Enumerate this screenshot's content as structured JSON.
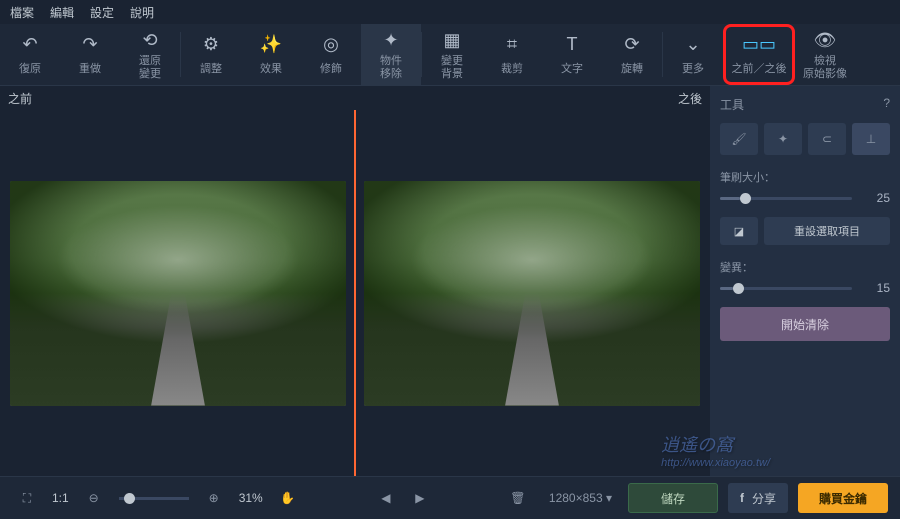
{
  "menu": {
    "file": "檔案",
    "edit": "編輯",
    "settings": "設定",
    "help": "說明"
  },
  "toolbar": {
    "undo": "復原",
    "redo": "重做",
    "revert": "還原\n變更",
    "adjust": "調整",
    "effects": "效果",
    "retouch": "修飾",
    "remove": "物件\n移除",
    "bgchange": "變更\n背景",
    "crop": "裁剪",
    "text": "文字",
    "rotate": "旋轉",
    "more": "更多",
    "beforeafter": "之前／之後",
    "original": "檢視\n原始影像"
  },
  "labels": {
    "before": "之前",
    "after": "之後"
  },
  "panel": {
    "title": "工具",
    "help": "?",
    "brushsize_label": "筆刷大小：",
    "brushsize_val": "25",
    "reset_label": "重設選取項目",
    "variation_label": "變異：",
    "variation_val": "15",
    "start_label": "開始清除"
  },
  "footer": {
    "ratio": "1:1",
    "zoom": "31%",
    "dimensions": "1280×853",
    "save": "儲存",
    "share": "分享",
    "buy": "購買金鑰"
  },
  "watermark": {
    "main": "逍遙の窩",
    "sub": "http://www.xiaoyao.tw/"
  }
}
